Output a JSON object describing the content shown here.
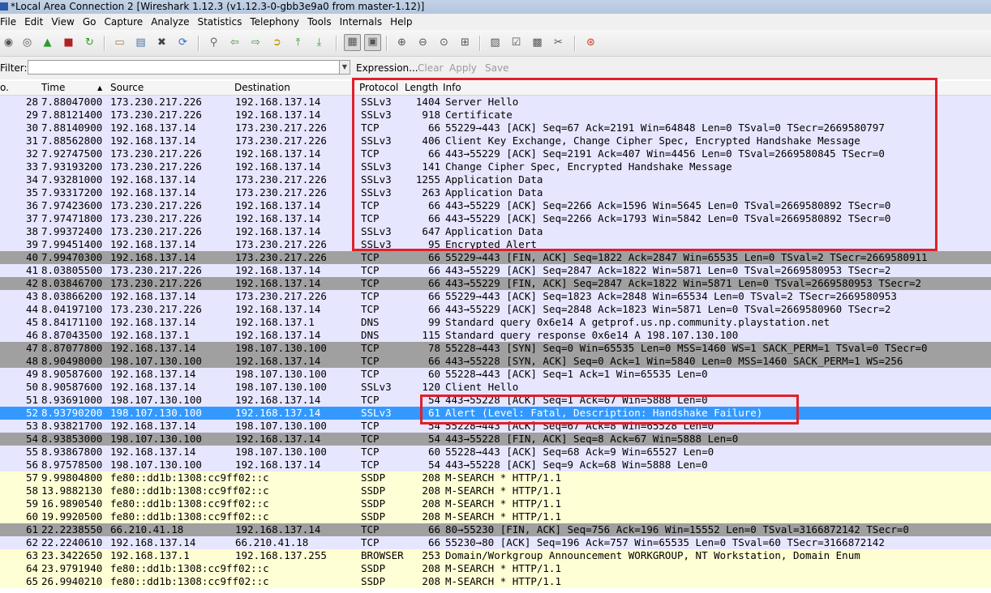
{
  "window": {
    "title": "*Local Area Connection 2   [Wireshark 1.12.3  (v1.12.3-0-gbb3e9a0 from master-1.12)]"
  },
  "menu": [
    "File",
    "Edit",
    "View",
    "Go",
    "Capture",
    "Analyze",
    "Statistics",
    "Telephony",
    "Tools",
    "Internals",
    "Help"
  ],
  "toolbar": {
    "icons": [
      {
        "name": "interfaces-icon",
        "glyph": "◉"
      },
      {
        "name": "options-icon",
        "glyph": "◎"
      },
      {
        "name": "start-capture-icon",
        "glyph": "▲"
      },
      {
        "name": "stop-capture-icon",
        "glyph": "■"
      },
      {
        "name": "restart-capture-icon",
        "glyph": "↻"
      },
      {
        "name": "open-file-icon",
        "glyph": "▭"
      },
      {
        "name": "save-file-icon",
        "glyph": "▤"
      },
      {
        "name": "close-file-icon",
        "glyph": "✖"
      },
      {
        "name": "reload-icon",
        "glyph": "⟳"
      },
      {
        "name": "find-packet-icon",
        "glyph": "⚲"
      },
      {
        "name": "go-back-icon",
        "glyph": "⇦"
      },
      {
        "name": "go-forward-icon",
        "glyph": "⇨"
      },
      {
        "name": "go-to-packet-icon",
        "glyph": "➲"
      },
      {
        "name": "go-first-icon",
        "glyph": "⤒"
      },
      {
        "name": "go-last-icon",
        "glyph": "⤓"
      },
      {
        "name": "colorize-icon",
        "glyph": "▦"
      },
      {
        "name": "auto-scroll-icon",
        "glyph": "▣"
      },
      {
        "name": "zoom-in-icon",
        "glyph": "⊕"
      },
      {
        "name": "zoom-out-icon",
        "glyph": "⊖"
      },
      {
        "name": "normal-size-icon",
        "glyph": "⊙"
      },
      {
        "name": "resize-columns-icon",
        "glyph": "⊞"
      },
      {
        "name": "capture-filters-icon",
        "glyph": "▨"
      },
      {
        "name": "display-filters-icon",
        "glyph": "☑"
      },
      {
        "name": "coloring-rules-icon",
        "glyph": "▩"
      },
      {
        "name": "preferences-icon",
        "glyph": "✂"
      },
      {
        "name": "help-icon",
        "glyph": "⊛"
      }
    ]
  },
  "filter": {
    "label": "Filter:",
    "value": "",
    "expression": "Expression...",
    "clear": "Clear",
    "apply": "Apply",
    "save": "Save"
  },
  "columns": {
    "no": "o.",
    "time": "Time",
    "source": "Source",
    "destination": "Destination",
    "protocol": "Protocol",
    "length": "Length",
    "info": "Info"
  },
  "colors": {
    "ssl": "#e7e6ff",
    "tcp": "#e7e6ff",
    "tcp_flag": "#a0a0a0",
    "dns": "#e7e6ff",
    "ssdp": "#ffffd6",
    "browser": "#fffdd2",
    "selected": "#3399ff",
    "highlight": "#e0202a"
  },
  "packets": [
    {
      "no": "28",
      "time": "7.88047000",
      "src": "173.230.217.226",
      "dst": "192.168.137.14",
      "proto": "SSLv3",
      "len": "1404",
      "info": "Server Hello",
      "kind": "ssl"
    },
    {
      "no": "29",
      "time": "7.88121400",
      "src": "173.230.217.226",
      "dst": "192.168.137.14",
      "proto": "SSLv3",
      "len": "918",
      "info": "Certificate",
      "kind": "ssl"
    },
    {
      "no": "30",
      "time": "7.88140900",
      "src": "192.168.137.14",
      "dst": "173.230.217.226",
      "proto": "TCP",
      "len": "66",
      "info": "55229→443 [ACK] Seq=67 Ack=2191 Win=64848 Len=0 TSval=0 TSecr=2669580797",
      "kind": "tcp"
    },
    {
      "no": "31",
      "time": "7.88562800",
      "src": "192.168.137.14",
      "dst": "173.230.217.226",
      "proto": "SSLv3",
      "len": "406",
      "info": "Client Key Exchange, Change Cipher Spec, Encrypted Handshake Message",
      "kind": "ssl"
    },
    {
      "no": "32",
      "time": "7.92747500",
      "src": "173.230.217.226",
      "dst": "192.168.137.14",
      "proto": "TCP",
      "len": "66",
      "info": "443→55229 [ACK] Seq=2191 Ack=407 Win=4456 Len=0 TSval=2669580845 TSecr=0",
      "kind": "tcp"
    },
    {
      "no": "33",
      "time": "7.93193200",
      "src": "173.230.217.226",
      "dst": "192.168.137.14",
      "proto": "SSLv3",
      "len": "141",
      "info": "Change Cipher Spec, Encrypted Handshake Message",
      "kind": "ssl"
    },
    {
      "no": "34",
      "time": "7.93281000",
      "src": "192.168.137.14",
      "dst": "173.230.217.226",
      "proto": "SSLv3",
      "len": "1255",
      "info": "Application Data",
      "kind": "ssl"
    },
    {
      "no": "35",
      "time": "7.93317200",
      "src": "192.168.137.14",
      "dst": "173.230.217.226",
      "proto": "SSLv3",
      "len": "263",
      "info": "Application Data",
      "kind": "ssl"
    },
    {
      "no": "36",
      "time": "7.97423600",
      "src": "173.230.217.226",
      "dst": "192.168.137.14",
      "proto": "TCP",
      "len": "66",
      "info": "443→55229 [ACK] Seq=2266 Ack=1596 Win=5645 Len=0 TSval=2669580892 TSecr=0",
      "kind": "tcp"
    },
    {
      "no": "37",
      "time": "7.97471800",
      "src": "173.230.217.226",
      "dst": "192.168.137.14",
      "proto": "TCP",
      "len": "66",
      "info": "443→55229 [ACK] Seq=2266 Ack=1793 Win=5842 Len=0 TSval=2669580892 TSecr=0",
      "kind": "tcp"
    },
    {
      "no": "38",
      "time": "7.99372400",
      "src": "173.230.217.226",
      "dst": "192.168.137.14",
      "proto": "SSLv3",
      "len": "647",
      "info": "Application Data",
      "kind": "ssl"
    },
    {
      "no": "39",
      "time": "7.99451400",
      "src": "192.168.137.14",
      "dst": "173.230.217.226",
      "proto": "SSLv3",
      "len": "95",
      "info": "Encrypted Alert",
      "kind": "ssl"
    },
    {
      "no": "40",
      "time": "7.99470300",
      "src": "192.168.137.14",
      "dst": "173.230.217.226",
      "proto": "TCP",
      "len": "66",
      "info": "55229→443 [FIN, ACK] Seq=1822 Ack=2847 Win=65535 Len=0 TSval=2 TSecr=2669580911",
      "kind": "tcp_flag"
    },
    {
      "no": "41",
      "time": "8.03805500",
      "src": "173.230.217.226",
      "dst": "192.168.137.14",
      "proto": "TCP",
      "len": "66",
      "info": "443→55229 [ACK] Seq=2847 Ack=1822 Win=5871 Len=0 TSval=2669580953 TSecr=2",
      "kind": "tcp"
    },
    {
      "no": "42",
      "time": "8.03846700",
      "src": "173.230.217.226",
      "dst": "192.168.137.14",
      "proto": "TCP",
      "len": "66",
      "info": "443→55229 [FIN, ACK] Seq=2847 Ack=1822 Win=5871 Len=0 TSval=2669580953 TSecr=2",
      "kind": "tcp_flag"
    },
    {
      "no": "43",
      "time": "8.03866200",
      "src": "192.168.137.14",
      "dst": "173.230.217.226",
      "proto": "TCP",
      "len": "66",
      "info": "55229→443 [ACK] Seq=1823 Ack=2848 Win=65534 Len=0 TSval=2 TSecr=2669580953",
      "kind": "tcp"
    },
    {
      "no": "44",
      "time": "8.04197100",
      "src": "173.230.217.226",
      "dst": "192.168.137.14",
      "proto": "TCP",
      "len": "66",
      "info": "443→55229 [ACK] Seq=2848 Ack=1823 Win=5871 Len=0 TSval=2669580960 TSecr=2",
      "kind": "tcp"
    },
    {
      "no": "45",
      "time": "8.84171100",
      "src": "192.168.137.14",
      "dst": "192.168.137.1",
      "proto": "DNS",
      "len": "99",
      "info": "Standard query 0x6e14  A getprof.us.np.community.playstation.net",
      "kind": "dns"
    },
    {
      "no": "46",
      "time": "8.87043500",
      "src": "192.168.137.1",
      "dst": "192.168.137.14",
      "proto": "DNS",
      "len": "115",
      "info": "Standard query response 0x6e14  A 198.107.130.100",
      "kind": "dns"
    },
    {
      "no": "47",
      "time": "8.87077800",
      "src": "192.168.137.14",
      "dst": "198.107.130.100",
      "proto": "TCP",
      "len": "78",
      "info": "55228→443 [SYN] Seq=0 Win=65535 Len=0 MSS=1460 WS=1 SACK_PERM=1 TSval=0 TSecr=0",
      "kind": "tcp_flag"
    },
    {
      "no": "48",
      "time": "8.90498000",
      "src": "198.107.130.100",
      "dst": "192.168.137.14",
      "proto": "TCP",
      "len": "66",
      "info": "443→55228 [SYN, ACK] Seq=0 Ack=1 Win=5840 Len=0 MSS=1460 SACK_PERM=1 WS=256",
      "kind": "tcp_flag"
    },
    {
      "no": "49",
      "time": "8.90587600",
      "src": "192.168.137.14",
      "dst": "198.107.130.100",
      "proto": "TCP",
      "len": "60",
      "info": "55228→443 [ACK] Seq=1 Ack=1 Win=65535 Len=0",
      "kind": "tcp"
    },
    {
      "no": "50",
      "time": "8.90587600",
      "src": "192.168.137.14",
      "dst": "198.107.130.100",
      "proto": "SSLv3",
      "len": "120",
      "info": "Client Hello",
      "kind": "ssl"
    },
    {
      "no": "51",
      "time": "8.93691000",
      "src": "198.107.130.100",
      "dst": "192.168.137.14",
      "proto": "TCP",
      "len": "54",
      "info": "443→55228 [ACK] Seq=1 Ack=67 Win=5888 Len=0",
      "kind": "tcp"
    },
    {
      "no": "52",
      "time": "8.93790200",
      "src": "198.107.130.100",
      "dst": "192.168.137.14",
      "proto": "SSLv3",
      "len": "61",
      "info": "Alert (Level: Fatal, Description: Handshake Failure)",
      "kind": "selected"
    },
    {
      "no": "53",
      "time": "8.93821700",
      "src": "192.168.137.14",
      "dst": "198.107.130.100",
      "proto": "TCP",
      "len": "54",
      "info": "55228→443 [ACK] Seq=67 Ack=8 Win=65528 Len=0",
      "kind": "tcp"
    },
    {
      "no": "54",
      "time": "8.93853000",
      "src": "198.107.130.100",
      "dst": "192.168.137.14",
      "proto": "TCP",
      "len": "54",
      "info": "443→55228 [FIN, ACK] Seq=8 Ack=67 Win=5888 Len=0",
      "kind": "tcp_flag"
    },
    {
      "no": "55",
      "time": "8.93867800",
      "src": "192.168.137.14",
      "dst": "198.107.130.100",
      "proto": "TCP",
      "len": "60",
      "info": "55228→443 [ACK] Seq=68 Ack=9 Win=65527 Len=0",
      "kind": "tcp"
    },
    {
      "no": "56",
      "time": "8.97578500",
      "src": "198.107.130.100",
      "dst": "192.168.137.14",
      "proto": "TCP",
      "len": "54",
      "info": "443→55228 [ACK] Seq=9 Ack=68 Win=5888 Len=0",
      "kind": "tcp"
    },
    {
      "no": "57",
      "time": "9.99804800",
      "src": "fe80::dd1b:1308:cc9ff02::c",
      "dst": "",
      "proto": "SSDP",
      "len": "208",
      "info": "M-SEARCH * HTTP/1.1",
      "kind": "ssdp"
    },
    {
      "no": "58",
      "time": "13.9882130",
      "src": "fe80::dd1b:1308:cc9ff02::c",
      "dst": "",
      "proto": "SSDP",
      "len": "208",
      "info": "M-SEARCH * HTTP/1.1",
      "kind": "ssdp"
    },
    {
      "no": "59",
      "time": "16.9890540",
      "src": "fe80::dd1b:1308:cc9ff02::c",
      "dst": "",
      "proto": "SSDP",
      "len": "208",
      "info": "M-SEARCH * HTTP/1.1",
      "kind": "ssdp"
    },
    {
      "no": "60",
      "time": "19.9920500",
      "src": "fe80::dd1b:1308:cc9ff02::c",
      "dst": "",
      "proto": "SSDP",
      "len": "208",
      "info": "M-SEARCH * HTTP/1.1",
      "kind": "ssdp"
    },
    {
      "no": "61",
      "time": "22.2238550",
      "src": "66.210.41.18",
      "dst": "192.168.137.14",
      "proto": "TCP",
      "len": "66",
      "info": "80→55230 [FIN, ACK] Seq=756 Ack=196 Win=15552 Len=0 TSval=3166872142 TSecr=0",
      "kind": "tcp_flag"
    },
    {
      "no": "62",
      "time": "22.2240610",
      "src": "192.168.137.14",
      "dst": "66.210.41.18",
      "proto": "TCP",
      "len": "66",
      "info": "55230→80 [ACK] Seq=196 Ack=757 Win=65535 Len=0 TSval=60 TSecr=3166872142",
      "kind": "tcp"
    },
    {
      "no": "63",
      "time": "23.3422650",
      "src": "192.168.137.1",
      "dst": "192.168.137.255",
      "proto": "BROWSER",
      "len": "253",
      "info": "Domain/Workgroup Announcement WORKGROUP, NT Workstation, Domain Enum",
      "kind": "browser"
    },
    {
      "no": "64",
      "time": "23.9791940",
      "src": "fe80::dd1b:1308:cc9ff02::c",
      "dst": "",
      "proto": "SSDP",
      "len": "208",
      "info": "M-SEARCH * HTTP/1.1",
      "kind": "ssdp"
    },
    {
      "no": "65",
      "time": "26.9940210",
      "src": "fe80::dd1b:1308:cc9ff02::c",
      "dst": "",
      "proto": "SSDP",
      "len": "208",
      "info": "M-SEARCH * HTTP/1.1",
      "kind": "ssdp"
    }
  ]
}
